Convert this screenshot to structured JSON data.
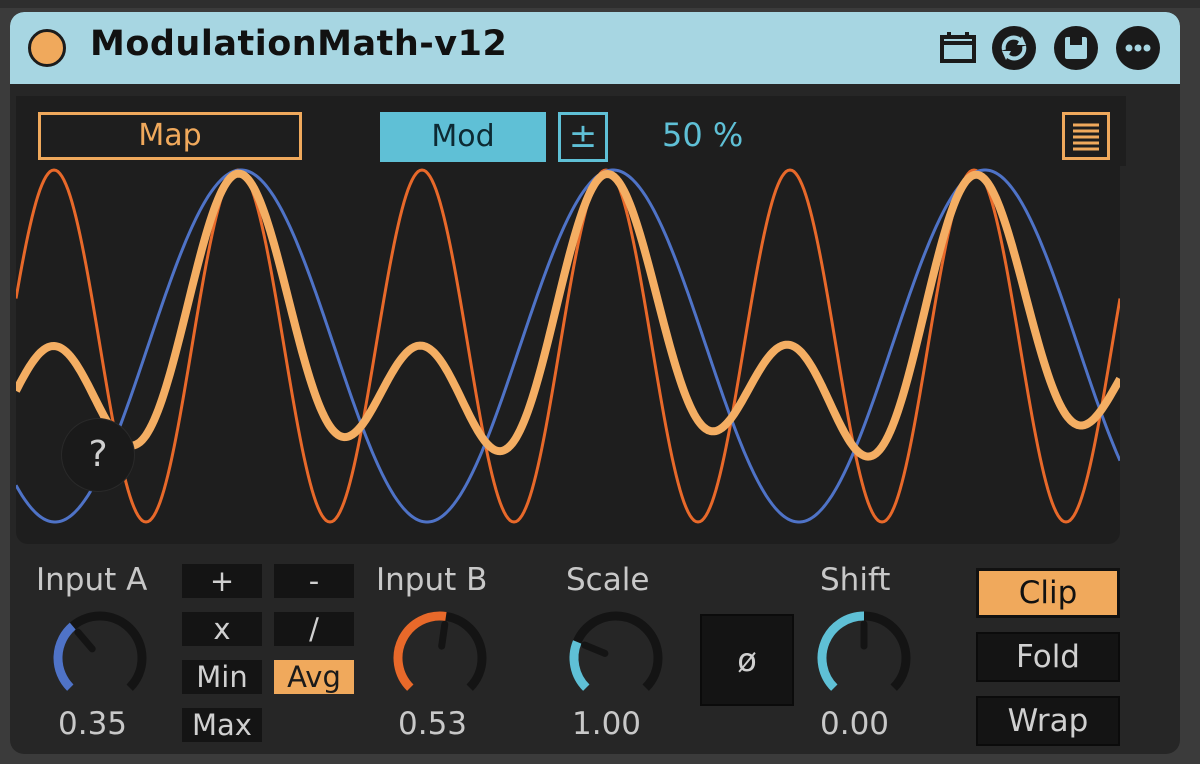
{
  "device": {
    "title": "ModulationMath-v12",
    "colors": {
      "titlebar": "#a7d6e2",
      "accent_orange": "#f0a95c",
      "accent_blue": "#5fc0d6",
      "wave_orange": "#e8692a",
      "wave_blue": "#4f73c7",
      "knob_a": "#4f73c7",
      "knob_b": "#e8692a",
      "knob_scale_shift": "#5fc0d6"
    },
    "title_icons": [
      "calendar-icon",
      "refresh-icon",
      "save-icon",
      "more-icon"
    ]
  },
  "display": {
    "map_label": "Map",
    "mod_label": "Mod",
    "bipolar_symbol": "±",
    "mod_amount": "50 %",
    "help_label": "?"
  },
  "controls": {
    "input_a": {
      "label": "Input A",
      "value_text": "0.35",
      "value": 0.35
    },
    "input_b": {
      "label": "Input B",
      "value_text": "0.53",
      "value": 0.53
    },
    "scale": {
      "label": "Scale",
      "value_text": "1.00",
      "value": 0.25
    },
    "shift": {
      "label": "Shift",
      "value_text": "0.00",
      "value": 0.5
    },
    "phase_label": "ø",
    "operations": [
      {
        "label": "+",
        "active": false
      },
      {
        "label": "-",
        "active": false
      },
      {
        "label": "x",
        "active": false
      },
      {
        "label": "/",
        "active": false
      },
      {
        "label": "Min",
        "active": false
      },
      {
        "label": "Avg",
        "active": true
      },
      {
        "label": "Max",
        "active": false
      }
    ],
    "modes": [
      {
        "label": "Clip",
        "active": true
      },
      {
        "label": "Fold",
        "active": false
      },
      {
        "label": "Wrap",
        "active": false
      }
    ]
  }
}
